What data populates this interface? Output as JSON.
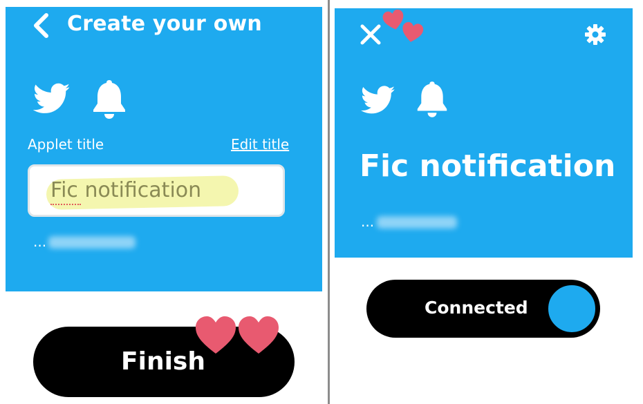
{
  "colors": {
    "accent": "#1eaaef",
    "button_dark": "#000000",
    "heart": "#e85a70",
    "highlight": "#f3f5a6"
  },
  "left_screen": {
    "header": {
      "title": "Create your own",
      "back_icon": "chevron-left-icon"
    },
    "services": {
      "trigger_icon": "twitter-icon",
      "action_icon": "bell-icon"
    },
    "applet_title_label": "Applet title",
    "edit_title_link": "Edit title",
    "title_input": {
      "value": "Fic notification"
    },
    "byline_prefix": "...",
    "finish_button": "Finish"
  },
  "right_screen": {
    "close_icon": "close-icon",
    "settings_icon": "gear-icon",
    "services": {
      "trigger_icon": "twitter-icon",
      "action_icon": "bell-icon"
    },
    "applet_title": "Fic notification",
    "byline_prefix": "...",
    "toggle": {
      "label": "Connected",
      "state": "on"
    }
  },
  "decorations": {
    "heart_icon": "heart-icon"
  }
}
